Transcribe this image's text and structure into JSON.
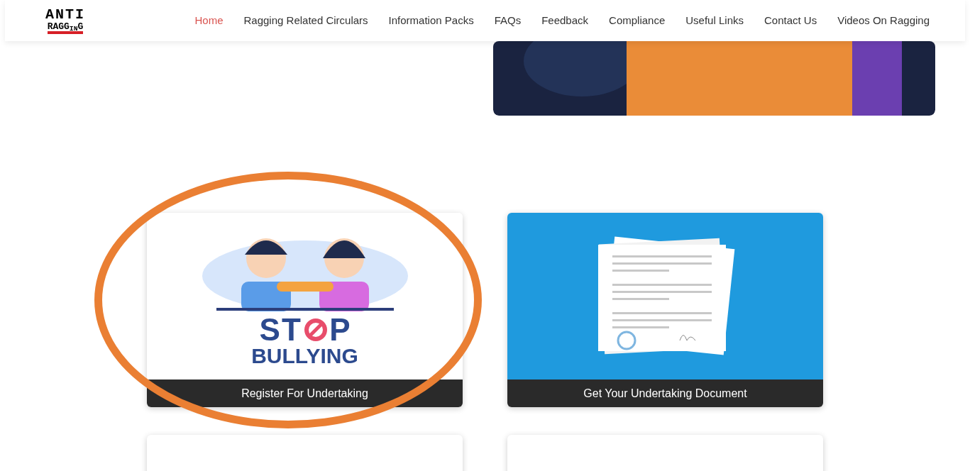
{
  "logo": {
    "top": "ANTI",
    "bottom": "RAGG$_{IN}$G"
  },
  "nav": [
    {
      "label": "Home",
      "selected": true
    },
    {
      "label": "Ragging Related Circulars",
      "selected": false
    },
    {
      "label": "Information Packs",
      "selected": false
    },
    {
      "label": "FAQs",
      "selected": false
    },
    {
      "label": "Feedback",
      "selected": false
    },
    {
      "label": "Compliance",
      "selected": false
    },
    {
      "label": "Useful Links",
      "selected": false
    },
    {
      "label": "Contact Us",
      "selected": false
    },
    {
      "label": "Videos On Ragging",
      "selected": false
    }
  ],
  "cards": [
    {
      "kind": "bullying",
      "art_text": [
        "ST",
        "P",
        "BULLYING"
      ],
      "caption": "Register For Undertaking",
      "circled": true
    },
    {
      "kind": "document",
      "caption": "Get Your Undertaking Document",
      "circled": false
    },
    {
      "kind": "blank"
    },
    {
      "kind": "blank"
    }
  ]
}
